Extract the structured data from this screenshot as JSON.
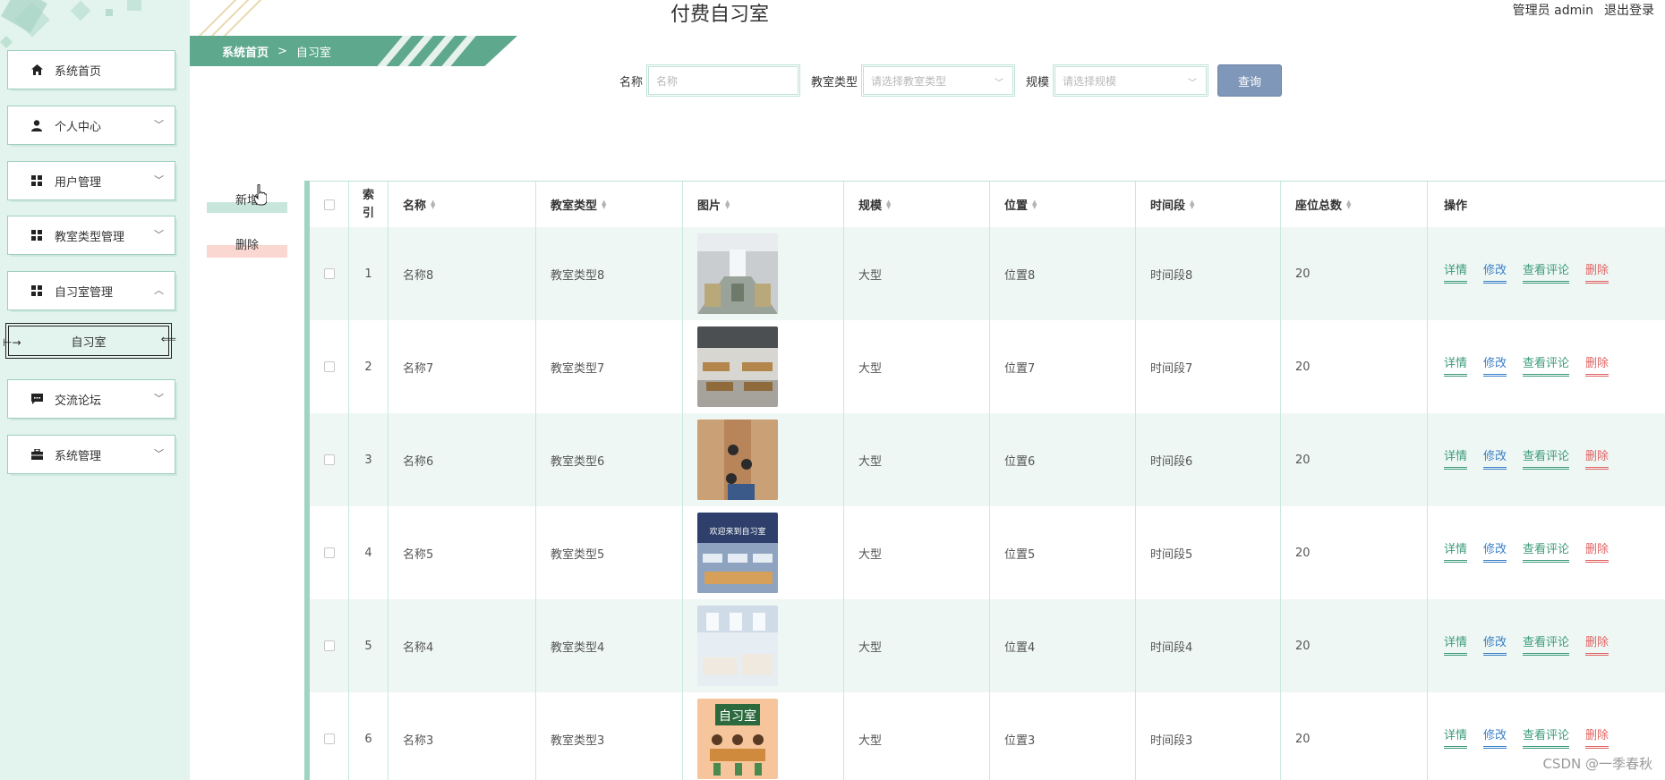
{
  "header": {
    "title": "付费自习室",
    "user_label": "管理员 admin",
    "logout_label": "退出登录"
  },
  "breadcrumb": {
    "home": "系统首页",
    "separator": ">",
    "current": "自习室"
  },
  "sidebar": {
    "items": [
      {
        "label": "系统首页",
        "icon": "home-icon",
        "expandable": false
      },
      {
        "label": "个人中心",
        "icon": "user-icon",
        "expandable": true
      },
      {
        "label": "用户管理",
        "icon": "grid-icon",
        "expandable": true
      },
      {
        "label": "教室类型管理",
        "icon": "grid-icon",
        "expandable": true
      },
      {
        "label": "自习室管理",
        "icon": "grid-icon",
        "expandable": true,
        "expanded": true
      },
      {
        "label": "交流论坛",
        "icon": "chat-icon",
        "expandable": true
      },
      {
        "label": "系统管理",
        "icon": "briefcase-icon",
        "expandable": true
      }
    ],
    "sub_item": "自习室"
  },
  "search": {
    "name_label": "名称",
    "name_placeholder": "名称",
    "type_label": "教室类型",
    "type_placeholder": "请选择教室类型",
    "scale_label": "规模",
    "scale_placeholder": "请选择规模",
    "query_button": "查询"
  },
  "actions": {
    "add": "新增",
    "delete": "删除"
  },
  "table": {
    "headers": {
      "index_line1": "索",
      "index_line2": "引",
      "name": "名称",
      "type": "教室类型",
      "image": "图片",
      "scale": "规模",
      "location": "位置",
      "time_slot": "时间段",
      "seats": "座位总数",
      "operations": "操作"
    },
    "ops": {
      "detail": "详情",
      "edit": "修改",
      "comments": "查看评论",
      "remove": "删除"
    },
    "rows": [
      {
        "index": "1",
        "name": "名称8",
        "type": "教室类型8",
        "scale": "大型",
        "location": "位置8",
        "time_slot": "时间段8",
        "seats": "20"
      },
      {
        "index": "2",
        "name": "名称7",
        "type": "教室类型7",
        "scale": "大型",
        "location": "位置7",
        "time_slot": "时间段7",
        "seats": "20"
      },
      {
        "index": "3",
        "name": "名称6",
        "type": "教室类型6",
        "scale": "大型",
        "location": "位置6",
        "time_slot": "时间段6",
        "seats": "20"
      },
      {
        "index": "4",
        "name": "名称5",
        "type": "教室类型5",
        "scale": "大型",
        "location": "位置5",
        "time_slot": "时间段5",
        "seats": "20"
      },
      {
        "index": "5",
        "name": "名称4",
        "type": "教室类型4",
        "scale": "大型",
        "location": "位置4",
        "time_slot": "时间段4",
        "seats": "20"
      },
      {
        "index": "6",
        "name": "名称3",
        "type": "教室类型3",
        "scale": "大型",
        "location": "位置3",
        "time_slot": "时间段3",
        "seats": "20"
      }
    ],
    "thumb_overlay_4": "欢迎来到自习室",
    "thumb_overlay_6": "自习室"
  },
  "watermark": "CSDN @一季春秋",
  "colors": {
    "sidebar_bg": "#e3f4ee",
    "accent_green": "#5ea88d",
    "query_button": "#7f97b8",
    "row_stripe": "#eef7f4",
    "delete_red": "#e06262",
    "edit_blue": "#3a7fc7"
  }
}
